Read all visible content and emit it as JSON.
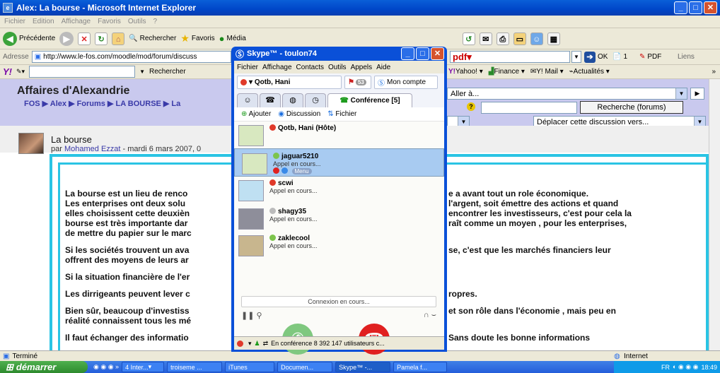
{
  "ie": {
    "title": "Alex: La bourse - Microsoft Internet Explorer",
    "menu": [
      "Fichier",
      "Edition",
      "Affichage",
      "Favoris",
      "Outils",
      "?"
    ],
    "toolbar": {
      "back": "Précédente",
      "search": "Rechercher",
      "favorites": "Favoris",
      "media": "Média"
    },
    "address_label": "Adresse",
    "address_value": "http://www.le-fos.com/moodle/mod/forum/discuss",
    "pdf_label": "pdf",
    "ok_label": "OK",
    "pdf_count": "1",
    "pdf_btn": "PDF",
    "links_label": "Liens",
    "yahoo": "Y!",
    "yahoo_search": "Rechercher",
    "yahoo_items": [
      "Yahoo!",
      "Finance",
      "Y! Mail",
      "Actualités"
    ],
    "status_text": "Terminé",
    "status_zone": "Internet"
  },
  "page": {
    "site_name": "Affaires d'Alexandrie",
    "breadcrumb": "FOS ▶ Alex ▶ Forums ▶ LA BOURSE ▶ La",
    "jump_select": "Aller à...",
    "search_button": "Recherche (forums)",
    "move_select": "Déplacer cette discussion vers...",
    "post_title": "La bourse",
    "post_by": "par",
    "post_author": "Mohamed Ezzat",
    "post_date": "- mardi 6 mars 2007, 0",
    "left_lines": [
      "La bourse est un lieu de renco",
      " Les enterprises ont deux solu",
      "elles choisissent cette deuxièn",
      " bourse est très importante dar",
      "de mettre du papier sur le marc",
      "Si les sociétés trouvent un ava",
      "offrent des moyens de leurs ar",
      "Si la situation financière de l'er",
      "Les dirrigeants peuvent lever c",
      "Bien sûr, beaucoup d'investiss",
      "réalité connaissent tous les mé",
      "Il faut échanger des informatio"
    ],
    "right_lines": [
      "e a avant tout un role économique.",
      "l'argent, soit émettre des actions et quand",
      "encontrer les investisseurs, c'est pour cela la",
      "raît comme un moyen , pour les enterprises,",
      "se, c'est que les marchés financiers leur",
      "ropres.",
      " et son rôle dans l'économie , mais peu en",
      "Sans doute les bonne informations"
    ]
  },
  "skype": {
    "title": "Skype™ - toulon74",
    "menu": [
      "Fichier",
      "Affichage",
      "Contacts",
      "Outils",
      "Appels",
      "Aide"
    ],
    "contact_button": "Qotb, Hani",
    "flag_count": "53",
    "account_button": "Mon compte",
    "conference_tab": "Conférence [5]",
    "actions": [
      "Ajouter",
      "Discussion",
      "Fichier"
    ],
    "participants": [
      {
        "name": "Qotb, Hani (Hôte)",
        "status": ""
      },
      {
        "name": "jaguar5210",
        "status": "Appel en cours...",
        "menu": "Menu"
      },
      {
        "name": "scwi",
        "status": "Appel en cours..."
      },
      {
        "name": "shagy35",
        "status": "Appel en cours..."
      },
      {
        "name": "zaklecool",
        "status": "Appel en cours..."
      }
    ],
    "connection_text": "Connexion en cours...",
    "status_text": "En conférence  8 392 147 utilisateurs c..."
  },
  "taskbar": {
    "start": "démarrer",
    "tasks": [
      "4 Inter...",
      "troiseme ...",
      "iTunes",
      "Documen...",
      "Skype™ -...",
      "Pamela f..."
    ],
    "lang": "FR",
    "clock": "18:49"
  },
  "colors": {
    "xp_blue": "#0a50d8",
    "cyan_border": "#2ac4e4",
    "moodle_header": "#c9c9ee",
    "hangup_red": "#e02020",
    "call_green": "#6fbf6f"
  }
}
